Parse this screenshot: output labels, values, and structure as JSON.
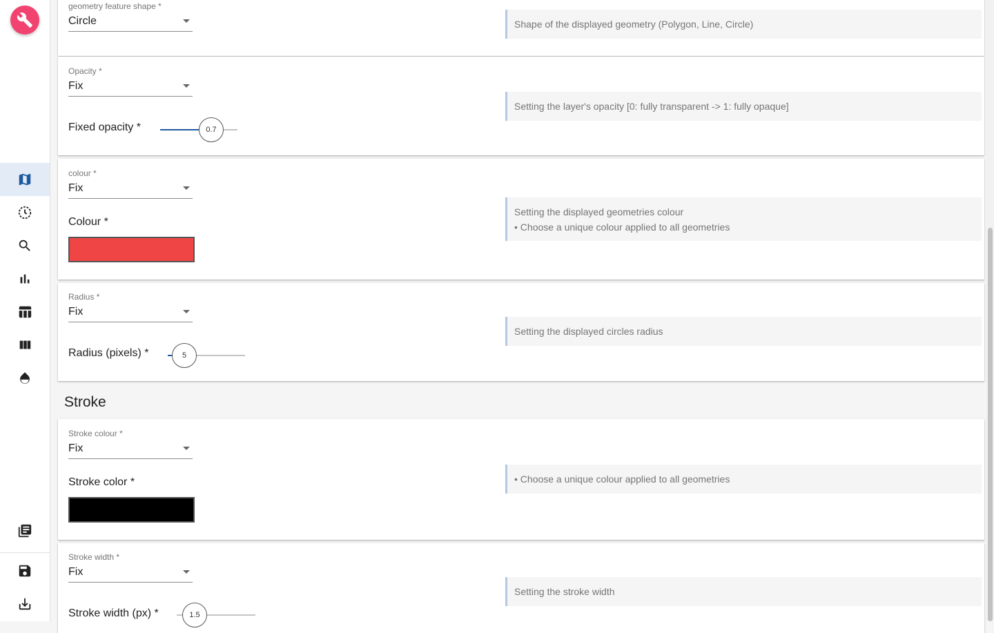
{
  "sidebar": {
    "fab_icon": "wrench-icon",
    "items": [
      {
        "icon": "map-icon",
        "active": true
      },
      {
        "icon": "time-icon",
        "active": false
      },
      {
        "icon": "search-icon",
        "active": false
      },
      {
        "icon": "bar-chart-icon",
        "active": false
      },
      {
        "icon": "table-icon",
        "active": false
      },
      {
        "icon": "columns-icon",
        "active": false
      },
      {
        "icon": "opacity-icon",
        "active": false
      },
      {
        "icon": "library-books-icon",
        "active": false
      },
      {
        "icon": "save-icon",
        "active": false
      },
      {
        "icon": "download-icon",
        "active": false
      }
    ]
  },
  "geometry": {
    "label": "geometry feature shape *",
    "value": "Circle",
    "help": "Shape of the displayed geometry (Polygon, Line, Circle)"
  },
  "opacity": {
    "label": "Opacity *",
    "value": "Fix",
    "fixed_label": "Fixed opacity *",
    "slider_value": "0.7",
    "slider_fraction": 0.7,
    "help": "Setting the layer's opacity [0: fully transparent -> 1: fully opaque]"
  },
  "colour": {
    "label": "colour *",
    "value": "Fix",
    "colour_label": "Colour *",
    "swatch_color": "#f04545",
    "help_line1": "Setting the displayed geometries colour",
    "help_line2": "• Choose a unique colour applied to all geometries"
  },
  "radius": {
    "label": "Radius *",
    "value": "Fix",
    "pixels_label": "Radius (pixels) *",
    "slider_value": "5",
    "help": "Setting the displayed circles radius"
  },
  "stroke": {
    "section_title": "Stroke",
    "colour_label": "Stroke colour *",
    "colour_value": "Fix",
    "color_label": "Stroke color *",
    "swatch_color": "#000000",
    "colour_help": "• Choose a unique colour applied to all geometries",
    "width_label": "Stroke width *",
    "width_value": "Fix",
    "width_px_label": "Stroke width (px) *",
    "width_slider_value": "1.5",
    "width_help": "Setting the stroke width"
  },
  "colors": {
    "accent": "#f1436f",
    "primary": "#1e5aa0",
    "active_nav_bg": "#e3ebf6"
  }
}
